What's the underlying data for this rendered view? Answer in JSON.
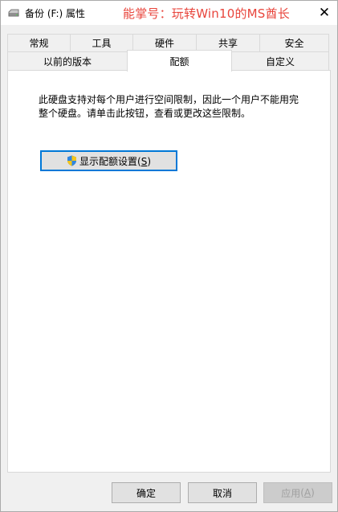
{
  "window": {
    "title": "备份 (F:) 属性",
    "watermark": "能掌号：玩转Win10的MS酋长",
    "close_glyph": "✕"
  },
  "tabs": {
    "row1": [
      "常规",
      "工具",
      "硬件",
      "共享",
      "安全"
    ],
    "row2": [
      "以前的版本",
      "配额",
      "自定义"
    ],
    "selected": "配额"
  },
  "panel": {
    "description": "此硬盘支持对每个用户进行空间限制，因此一个用户不能用完整个硬盘。请单击此按钮，查看或更改这些限制。",
    "quota_button_label": "显示配额设置",
    "quota_button_hotkey": "S"
  },
  "buttons": {
    "ok": "确定",
    "cancel": "取消",
    "apply": "应用",
    "apply_hotkey": "A"
  },
  "icons": {
    "title": "drive-icon",
    "quota_button": "uac-shield-icon"
  },
  "colors": {
    "watermark": "#e8453c",
    "focus_border": "#0078d7"
  }
}
